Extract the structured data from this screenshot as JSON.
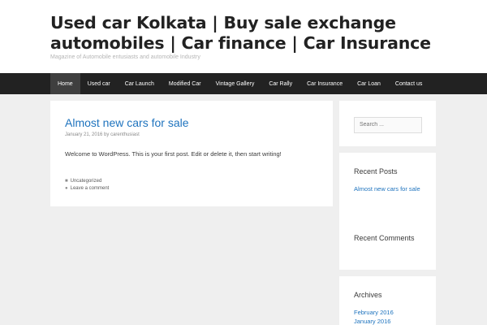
{
  "header": {
    "title": "Used car Kolkata | Buy sale exchange automobiles | Car finance | Car Insurance",
    "description": "Magazine of Automobile entusiasts and automobile Industry"
  },
  "nav": {
    "items": [
      {
        "label": "Home",
        "active": true
      },
      {
        "label": "Used car"
      },
      {
        "label": "Car Launch"
      },
      {
        "label": "Modified Car"
      },
      {
        "label": "Vintage Gallery"
      },
      {
        "label": "Car Rally"
      },
      {
        "label": "Car Insurance"
      },
      {
        "label": "Car Loan"
      },
      {
        "label": "Contact us"
      }
    ]
  },
  "post": {
    "title": "Almost new cars for sale",
    "date": "January 21, 2016",
    "by": "by",
    "author": "carenthusiast",
    "body": "Welcome to WordPress. This is your first post. Edit or delete it, then start writing!",
    "category": "Uncategorized",
    "comment_link": "Leave a comment"
  },
  "sidebar": {
    "search_placeholder": "Search ...",
    "recent_posts_title": "Recent Posts",
    "recent_posts": [
      "Almost new cars for sale"
    ],
    "recent_comments_title": "Recent Comments",
    "archives_title": "Archives",
    "archives": [
      "February 2016",
      "January 2016"
    ]
  },
  "colors": {
    "link": "#1e73be",
    "nav_bg": "#222222",
    "nav_active": "#3f3f3f",
    "page_bg": "#efefef"
  }
}
